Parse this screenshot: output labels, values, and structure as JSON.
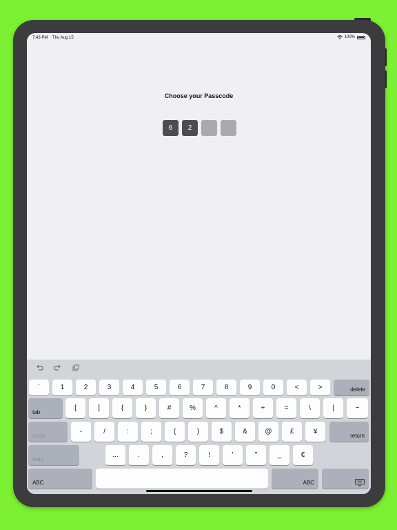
{
  "status_bar": {
    "time": "7:43 PM",
    "date": "Thu Aug 15",
    "battery": "100%"
  },
  "passcode": {
    "title": "Choose your Passcode",
    "digits": [
      "6",
      "2",
      "",
      ""
    ]
  },
  "keyboard": {
    "toolbar": {
      "undo_icon": "undo-arrow-icon",
      "redo_icon": "redo-arrow-icon",
      "paste_icon": "clipboard-icon"
    },
    "row1": [
      "`",
      "1",
      "2",
      "3",
      "4",
      "5",
      "6",
      "7",
      "8",
      "9",
      "0",
      "<",
      ">"
    ],
    "delete": "delete",
    "tab": "tab",
    "row2": [
      "[",
      "]",
      "{",
      "}",
      "#",
      "%",
      "^",
      "*",
      "+",
      "=",
      "\\",
      "|",
      "~"
    ],
    "undo": "undo",
    "row3": [
      "-",
      "/",
      ":",
      ";",
      "(",
      ")",
      "$",
      "&",
      "@",
      "£",
      "¥"
    ],
    "return": "return",
    "redo": "redo",
    "row4": [
      "…",
      ".",
      ",",
      "?",
      "!",
      "’",
      "”",
      "_",
      "€"
    ],
    "abc_left": "ABC",
    "abc_right": "ABC",
    "dismiss_icon": "keyboard-dismiss-icon"
  }
}
